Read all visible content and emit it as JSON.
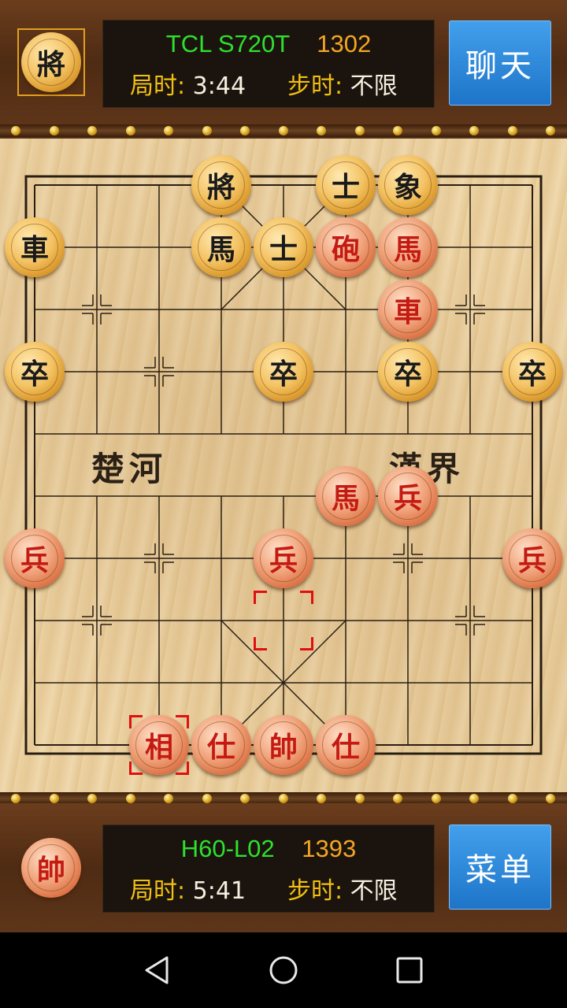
{
  "top_player": {
    "avatar_glyph": "將",
    "device": "TCL S720T",
    "rating": "1302",
    "game_time_label": "局时:",
    "game_time": "3:44",
    "step_time_label": "步时:",
    "step_time": "不限"
  },
  "chat_button": "聊天",
  "bottom_player": {
    "avatar_glyph": "帥",
    "device": "H60-L02",
    "rating": "1393",
    "game_time_label": "局时:",
    "game_time": "5:41",
    "step_time_label": "步时:",
    "step_time": "不限"
  },
  "menu_button": "菜单",
  "river": {
    "left": "楚河",
    "right": "漢界"
  },
  "board": {
    "files": 9,
    "ranks": 10,
    "pieces": [
      {
        "side": "black",
        "glyph": "將",
        "file": 3,
        "rank": 0
      },
      {
        "side": "black",
        "glyph": "士",
        "file": 5,
        "rank": 0
      },
      {
        "side": "black",
        "glyph": "象",
        "file": 6,
        "rank": 0
      },
      {
        "side": "black",
        "glyph": "車",
        "file": 0,
        "rank": 1
      },
      {
        "side": "black",
        "glyph": "馬",
        "file": 3,
        "rank": 1
      },
      {
        "side": "black",
        "glyph": "士",
        "file": 4,
        "rank": 1
      },
      {
        "side": "red",
        "glyph": "砲",
        "file": 5,
        "rank": 1
      },
      {
        "side": "red",
        "glyph": "馬",
        "file": 6,
        "rank": 1
      },
      {
        "side": "red",
        "glyph": "車",
        "file": 6,
        "rank": 2
      },
      {
        "side": "black",
        "glyph": "卒",
        "file": 0,
        "rank": 3
      },
      {
        "side": "black",
        "glyph": "卒",
        "file": 4,
        "rank": 3
      },
      {
        "side": "black",
        "glyph": "卒",
        "file": 6,
        "rank": 3
      },
      {
        "side": "black",
        "glyph": "卒",
        "file": 8,
        "rank": 3
      },
      {
        "side": "red",
        "glyph": "馬",
        "file": 5,
        "rank": 5
      },
      {
        "side": "red",
        "glyph": "兵",
        "file": 6,
        "rank": 5
      },
      {
        "side": "red",
        "glyph": "兵",
        "file": 0,
        "rank": 6
      },
      {
        "side": "red",
        "glyph": "兵",
        "file": 4,
        "rank": 6
      },
      {
        "side": "red",
        "glyph": "兵",
        "file": 8,
        "rank": 6
      },
      {
        "side": "red",
        "glyph": "相",
        "file": 2,
        "rank": 9
      },
      {
        "side": "red",
        "glyph": "仕",
        "file": 3,
        "rank": 9
      },
      {
        "side": "red",
        "glyph": "帥",
        "file": 4,
        "rank": 9
      },
      {
        "side": "red",
        "glyph": "仕",
        "file": 5,
        "rank": 9
      }
    ],
    "last_move": {
      "from": {
        "file": 4,
        "rank": 7
      },
      "to": {
        "file": 2,
        "rank": 9
      }
    }
  },
  "nav": {
    "back": "back-icon",
    "home": "home-icon",
    "recent": "recent-apps-icon"
  },
  "colors": {
    "red_text": "#c41a12",
    "black_text": "#1a1a1a",
    "green_name": "#2ee02e",
    "rating": "#f5a623",
    "label": "#f2c010",
    "button": "#2a86dc"
  }
}
